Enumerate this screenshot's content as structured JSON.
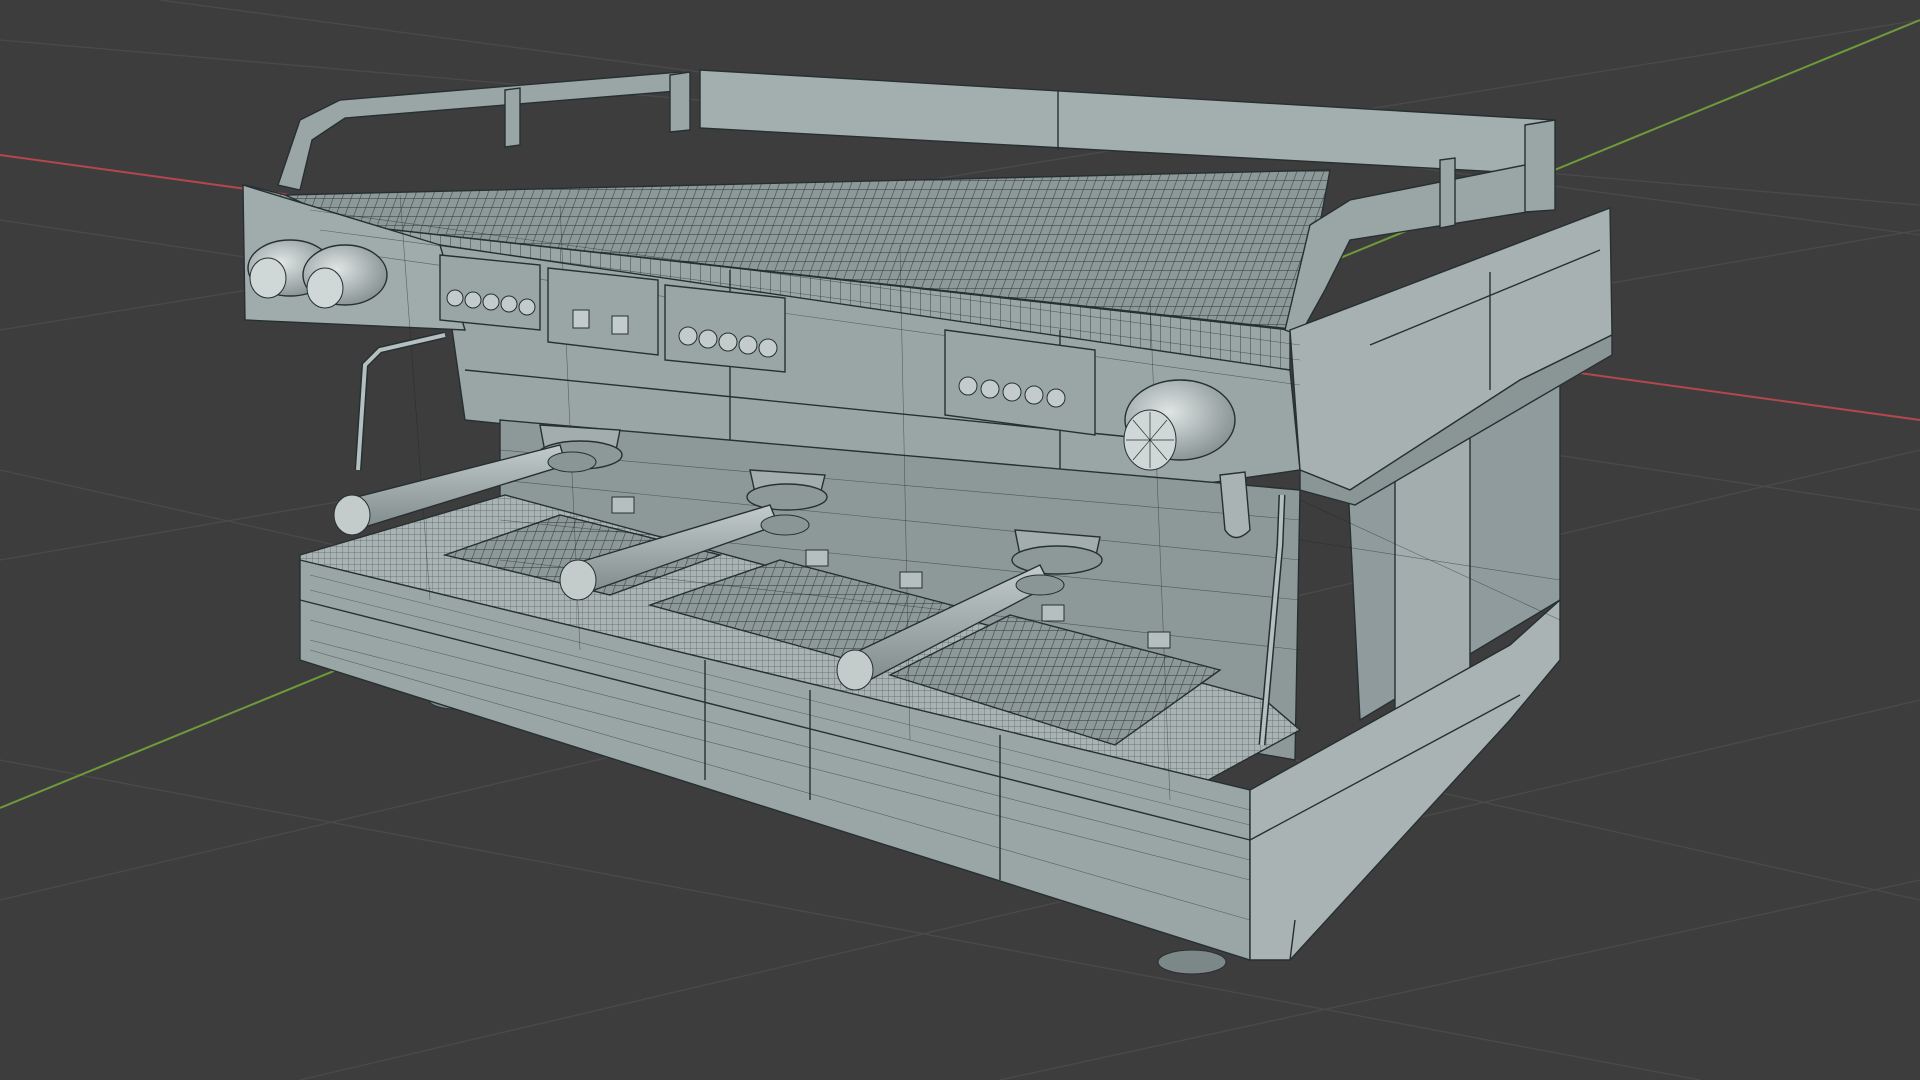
{
  "viewport": {
    "background": "#3d3d3d",
    "grid_color": "#4a4a4a",
    "axis_x_color": "#b2474d",
    "axis_y_color": "#6f9a3a",
    "mesh_base_color": "#9aa6a6",
    "mesh_light_color": "#b5bfbf",
    "mesh_dark_color": "#7c8788",
    "wire_color": "#263032",
    "display_mode": "wireframe-overlay"
  },
  "model": {
    "object": "espresso-machine",
    "groups": 3,
    "portafilters": 3,
    "steam_wands": 2,
    "knobs": 3,
    "button_panels": 4,
    "drip_trays": 3
  }
}
